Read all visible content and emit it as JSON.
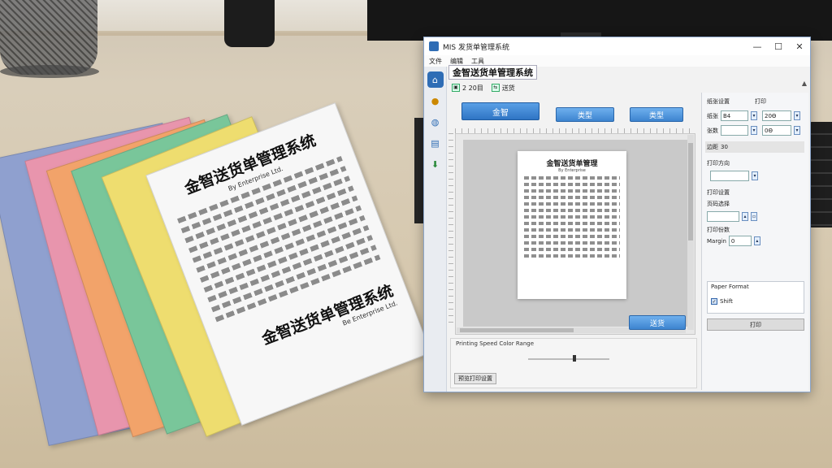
{
  "paper": {
    "title": "金智送货单管理系统",
    "subtitle": "By Enterprise Ltd.",
    "footer_title": "金智送货单管理系统",
    "footer_sub": "Be Enterprise Ltd."
  },
  "window": {
    "title": "MIS 发货单管理系统",
    "controls": {
      "minimize": "—",
      "maximize": "☐",
      "close": "✕"
    }
  },
  "menu": [
    "文件",
    "编辑",
    "工具"
  ],
  "app_title": "金智送货单管理系统",
  "tabs": [
    {
      "icon": "▣",
      "label": "2 20目"
    },
    {
      "icon": "⇆",
      "label": "送货"
    }
  ],
  "toolbar": {
    "primary_label": "金智",
    "btn2_label": "类型",
    "btn3_label": "类型"
  },
  "preview": {
    "page_title": "金智送货单管理",
    "page_sub": "By Enterprise",
    "apply_label": "送货"
  },
  "bottom_panel": {
    "label": "Printing Speed Color Range",
    "reset_label": "预览打印设置"
  },
  "side": {
    "header_left": "纸张设置",
    "header_right": "打印",
    "row1_label": "纸张",
    "row1_value": "B4",
    "row1_value2": "20Θ",
    "row2_label": "张数",
    "row2_value": "",
    "row2_value2": "0Θ",
    "row3_label": "边距",
    "row3_value": "30",
    "sec1": "打印方向",
    "sec2": "打印设置",
    "sec3": "页码选择",
    "sec4": "打印份数",
    "sec4_unit": "0",
    "sec5_label": "Margin",
    "group_title": "Paper Format",
    "check_label": "Shift",
    "action_label": "打印"
  }
}
